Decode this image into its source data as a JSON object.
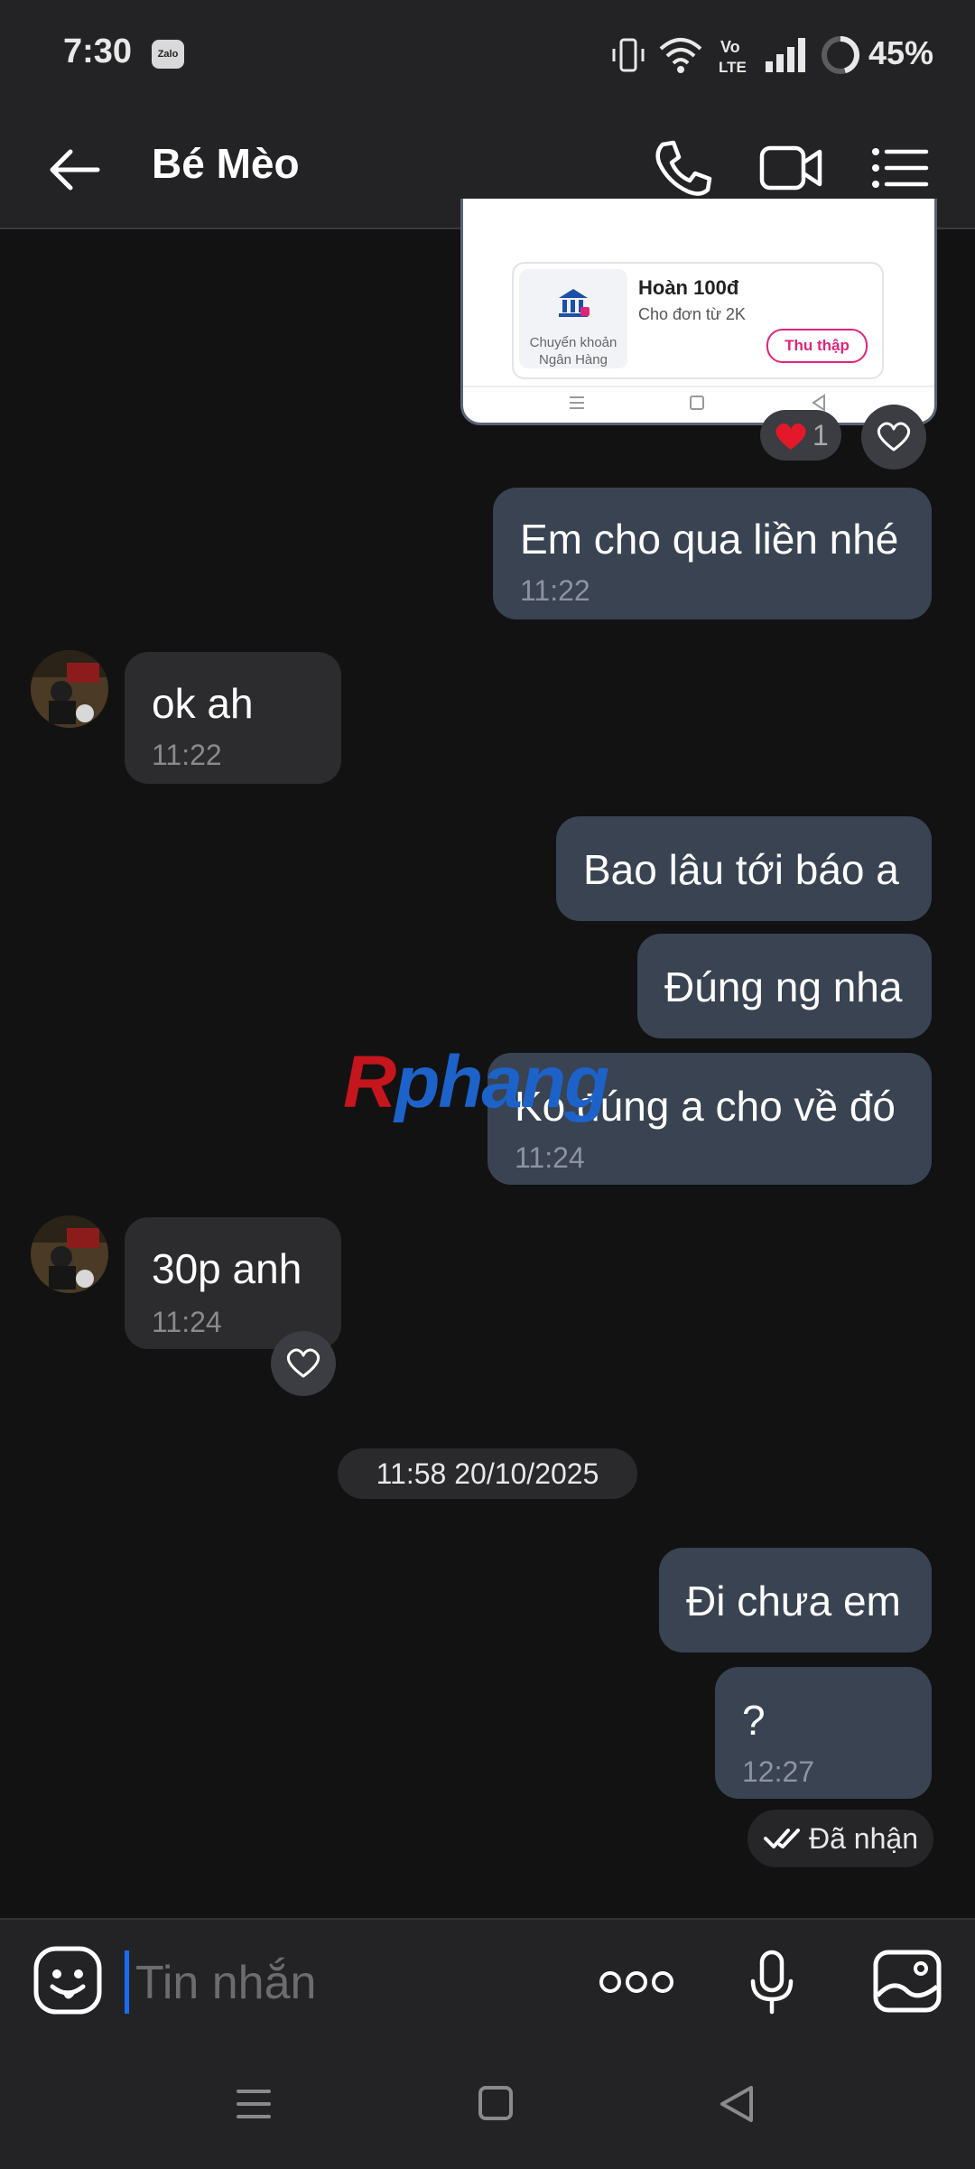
{
  "status_bar": {
    "time": "7:30",
    "app_badge": "Zalo",
    "battery": "45%",
    "icons": [
      "vibrate-icon",
      "wifi-icon",
      "volte-icon",
      "signal-icon",
      "battery-icon"
    ],
    "volte_label": "Vo\nLTE"
  },
  "header": {
    "title": "Bé Mèo",
    "icons": [
      "back-arrow-icon",
      "phone-icon",
      "video-call-icon",
      "menu-list-icon"
    ]
  },
  "screenshot_preview": {
    "bank_label": "Chuyển khoản Ngân Hàng",
    "hoan": "Hoàn 100đ",
    "cho_don": "Cho đơn từ 2K",
    "collect_button": "Thu thập"
  },
  "reaction": {
    "emoji": "❤️",
    "count": "1"
  },
  "messages": [
    {
      "side": "out",
      "text": "Em cho qua liền nhé",
      "time": "11:22"
    },
    {
      "side": "in",
      "text": "ok ah",
      "time": "11:22"
    },
    {
      "side": "out",
      "text": "Bao lâu tới báo a",
      "time": ""
    },
    {
      "side": "out",
      "text": "Đúng ng nha",
      "time": ""
    },
    {
      "side": "out",
      "text": "Ko đúng a cho về đó",
      "time": "11:24"
    },
    {
      "side": "in",
      "text": "30p anh",
      "time": "11:24"
    },
    {
      "side": "out",
      "text": "Đi chưa em",
      "time": ""
    },
    {
      "side": "out",
      "text": "?",
      "time": "12:27"
    }
  ],
  "date_separator": "11:58 20/10/2025",
  "delivery_status": "Đã nhận",
  "watermark": "Rphang",
  "input": {
    "placeholder": "Tin nhắn"
  },
  "colors": {
    "background": "#121213",
    "bar": "#232325",
    "outgoing_bubble": "#394352",
    "incoming_bubble": "#2c2c2e",
    "accent_caret": "#1b6cf2",
    "watermark_red": "#c4161c",
    "watermark_blue": "#1d62c9"
  }
}
